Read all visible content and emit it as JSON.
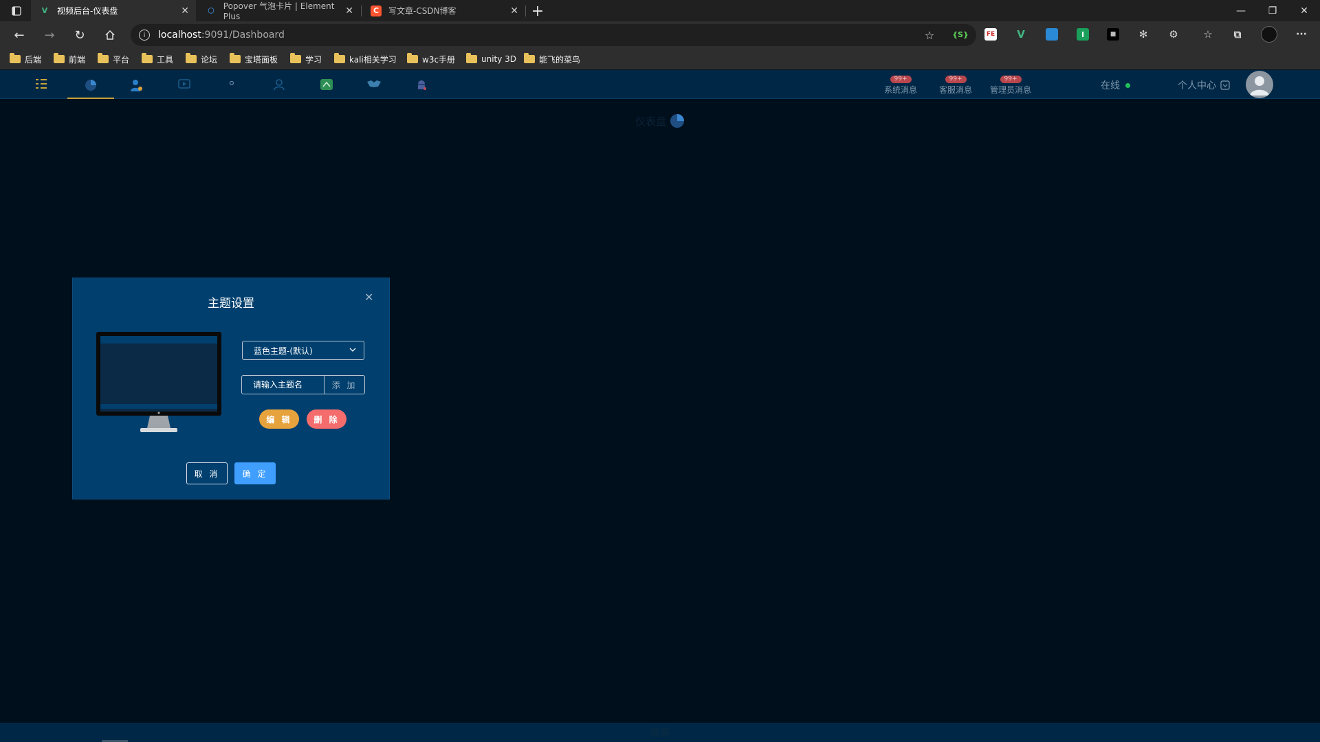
{
  "browser": {
    "tabs": [
      {
        "title": "视频后台-仪表盘",
        "active": true
      },
      {
        "title": "Popover 气泡卡片 | Element Plus",
        "active": false
      },
      {
        "title": "写文章-CSDN博客",
        "active": false
      }
    ],
    "address": {
      "host": "localhost",
      "path": ":9091/Dashboard"
    },
    "bookmarks": [
      "后端",
      "前端",
      "平台",
      "工具",
      "论坛",
      "宝塔面板",
      "学习",
      "kali相关学习",
      "w3c手册",
      "unity 3D",
      "能飞的菜鸟"
    ],
    "extensions": [
      "favicon-s-icon",
      "fe-icon",
      "vue-devtools-icon",
      "blue-ext-icon",
      "green-ext-icon",
      "black-ext-icon",
      "gear-ext-icon",
      "puzzle-icon"
    ]
  },
  "app": {
    "nav_icons": [
      "menu-grid-icon",
      "dashboard-pie-icon",
      "user-manage-icon",
      "video-icon",
      "dot-icon",
      "people-icon",
      "green-box-icon",
      "handshake-icon",
      "android-icon"
    ],
    "messages": [
      {
        "badge": "99+",
        "label": "系统消息"
      },
      {
        "badge": "99+",
        "label": "客服消息"
      },
      {
        "badge": "99+",
        "label": "管理员消息"
      }
    ],
    "online_label": "在线",
    "profile_label": "个人中心",
    "page_title": "仪表盘",
    "footer": "底部"
  },
  "dialog": {
    "title": "主题设置",
    "theme_select_value": "蓝色主题-(默认)",
    "theme_input_placeholder": "请输入主题名",
    "add_label": "添 加",
    "edit_label": "编 辑",
    "delete_label": "删 除",
    "cancel_label": "取 消",
    "ok_label": "确 定"
  },
  "colors": {
    "page_bg": "#000f1c",
    "nav_bg": "#002846",
    "dialog_bg": "#003f6e",
    "primary": "#409eff",
    "warning": "#e6a23c",
    "danger": "#f56c6c",
    "badge": "#b7464d",
    "online": "#22c25a"
  }
}
